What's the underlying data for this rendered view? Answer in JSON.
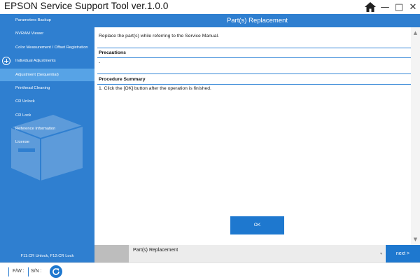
{
  "window": {
    "title": "EPSON Service Support Tool  ver.1.0.0",
    "buttons": {
      "home_icon": "home-icon",
      "minimize": "—",
      "maximize": "□",
      "close": "✕"
    }
  },
  "sidebar": {
    "items": [
      {
        "label": "Parameters Backup"
      },
      {
        "label": "NVRAM Viewer"
      },
      {
        "label": "Color Measurement / Offset Registration"
      },
      {
        "label": "Individual Adjustments",
        "icon": "plus-circle-icon"
      },
      {
        "label": "Adjustment (Sequential)",
        "active": true
      },
      {
        "label": "Printhead Cleaning"
      },
      {
        "label": "CR Unlock"
      },
      {
        "label": "CR Lock"
      },
      {
        "label": "Reference Information"
      },
      {
        "label": "License"
      }
    ],
    "footer": "F11:CR Unlock, F12:CR Lock"
  },
  "header": {
    "title": "Part(s) Replacement"
  },
  "content": {
    "intro": "Replace the part(s) while referring to the Service Manual.",
    "precautions": {
      "title": "Precautions",
      "body": "-"
    },
    "procedure": {
      "title": "Procedure Summary",
      "steps": [
        "1.   Click the [OK] button after the operation is finished."
      ]
    },
    "ok_label": "OK"
  },
  "stepbar": {
    "current_step": "Part(s) Replacement",
    "next_label": "next >"
  },
  "status": {
    "fw_label": "F/W :",
    "sn_label": "S/N :"
  },
  "colors": {
    "accent": "#2f7fd0",
    "active_item": "#57a3e6",
    "button": "#1e78cf"
  }
}
